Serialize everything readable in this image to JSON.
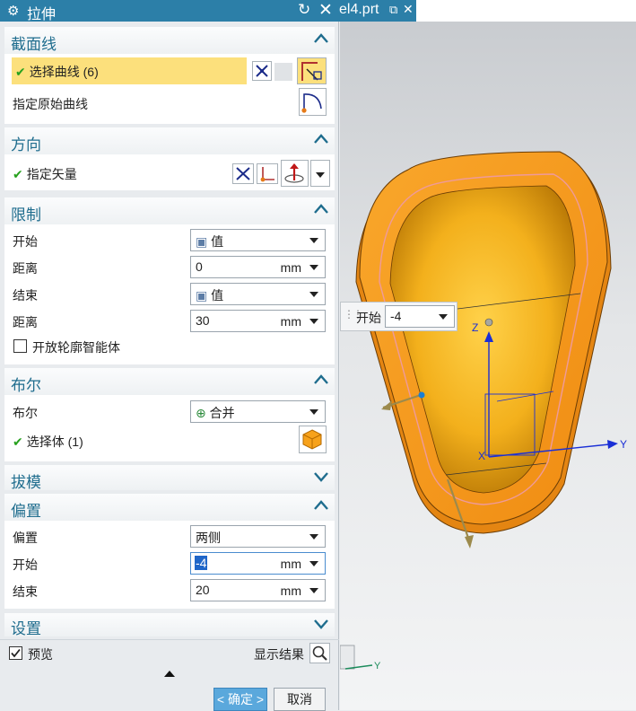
{
  "dialog": {
    "title": "拉伸",
    "sections": {
      "section_curve": {
        "title": "截面线",
        "select_curve_label": "选择曲线 (6)",
        "specify_origin_label": "指定原始曲线"
      },
      "direction": {
        "title": "方向",
        "specify_vector_label": "指定矢量"
      },
      "limits": {
        "title": "限制",
        "start_label": "开始",
        "start_value": "值",
        "distance1_label": "距离",
        "distance1_value": "0",
        "distance1_unit": "mm",
        "end_label": "结束",
        "end_value": "值",
        "distance2_label": "距离",
        "distance2_value": "30",
        "distance2_unit": "mm",
        "open_profile_label": "开放轮廓智能体",
        "open_profile_checked": false
      },
      "boolean": {
        "title": "布尔",
        "boolean_label": "布尔",
        "boolean_value": "合并",
        "select_body_label": "选择体 (1)"
      },
      "draft": {
        "title": "拔模"
      },
      "offset": {
        "title": "偏置",
        "offset_label": "偏置",
        "offset_value": "两侧",
        "start_label": "开始",
        "start_value": "-4",
        "start_unit": "mm",
        "end_label": "结束",
        "end_value": "20",
        "end_unit": "mm"
      },
      "settings": {
        "title": "设置"
      }
    },
    "preview_label": "预览",
    "preview_checked": true,
    "show_result_label": "显示结果",
    "ok_label": "< 确定 >",
    "cancel_label": "取消"
  },
  "tab": {
    "label": "el4.prt"
  },
  "viewport": {
    "float_start_label": "开始",
    "float_start_value": "-4",
    "axis_y": "Y",
    "axis_z": "Z",
    "axis_x": "X",
    "triad_y": "Y"
  },
  "colors": {
    "title_bar": "#2c7fa8",
    "section_title": "#1f6d8e",
    "selected_row": "#fce07c",
    "model_orange": "#f5a623",
    "check_green": "#27a11e",
    "axis_blue": "#1a2fd6"
  },
  "icons": {
    "settings": "gear-icon",
    "reset": "reset-icon",
    "close": "close-icon",
    "expand": "chevron-up-icon",
    "collapse": "chevron-down-icon",
    "search": "magnifier-icon"
  }
}
